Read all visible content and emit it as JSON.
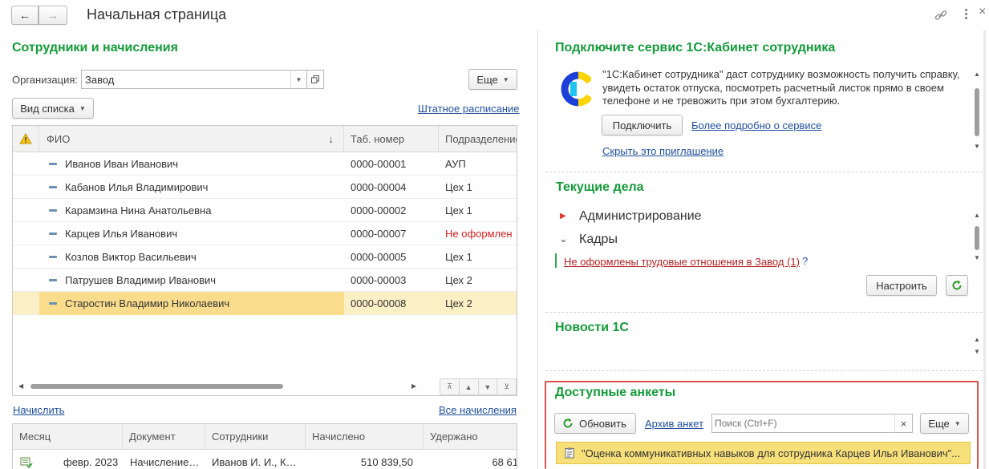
{
  "window": {
    "title": "Начальная страница",
    "nav_back": "←",
    "nav_forward": "→"
  },
  "employees": {
    "title": "Сотрудники и начисления",
    "org_label": "Организация:",
    "org_value": "Завод",
    "more_label": "Еще",
    "view_list_label": "Вид списка",
    "staff_schedule_link": "Штатное расписание",
    "columns": {
      "warn": "",
      "fio": "ФИО",
      "sort_arrow": "↓",
      "tab_number": "Таб. номер",
      "department": "Подразделение"
    },
    "rows": [
      {
        "fio": "Иванов Иван Иванович",
        "tab": "0000-00001",
        "dept": "АУП",
        "dept_color": "#333333"
      },
      {
        "fio": "Кабанов Илья Владимирович",
        "tab": "0000-00004",
        "dept": "Цех 1",
        "dept_color": "#333333"
      },
      {
        "fio": "Карамзина Нина Анатольевна",
        "tab": "0000-00002",
        "dept": "Цех 1",
        "dept_color": "#333333"
      },
      {
        "fio": "Карцев Илья Иванович",
        "tab": "0000-00007",
        "dept": "Не оформлен",
        "dept_color": "#d42020"
      },
      {
        "fio": "Козлов Виктор Васильевич",
        "tab": "0000-00005",
        "dept": "Цех 1",
        "dept_color": "#333333"
      },
      {
        "fio": "Патрушев Владимир Иванович",
        "tab": "0000-00003",
        "dept": "Цех 2",
        "dept_color": "#333333"
      },
      {
        "fio": "Старостин Владимир Николаевич",
        "tab": "0000-00008",
        "dept": "Цех 2",
        "dept_color": "#333333"
      }
    ],
    "selected_row": 6,
    "accrue_link": "Начислить",
    "all_accruals_link": "Все начисления"
  },
  "accruals": {
    "columns": {
      "month": "Месяц",
      "document": "Документ",
      "employees": "Сотрудники",
      "accrued": "Начислено",
      "withheld": "Удержано"
    },
    "rows": [
      {
        "month": "февр. 2023",
        "document": "Начисление…",
        "employees": "Иванов И. И., К…",
        "accrued": "510 839,50",
        "withheld": "68 61"
      }
    ]
  },
  "cabinet": {
    "title": "Подключите сервис 1С:Кабинет сотрудника",
    "description": "\"1С:Кабинет сотрудника\" даст сотруднику возможность получить справку, увидеть остаток отпуска, посмотреть расчетный листок прямо в своем телефоне и не тревожить при этом бухгалтерию.",
    "connect_button": "Подключить",
    "more_link": "Более подробно о сервисе",
    "hide_link": "Скрыть это приглашение"
  },
  "tasks": {
    "title": "Текущие дела",
    "items": [
      {
        "label": "Администрирование",
        "icon": "triangle-right"
      },
      {
        "label": "Кадры",
        "icon": "chevron-down"
      }
    ],
    "alert_link": "Не оформлены трудовые отношения в Завод (1)",
    "help": "?",
    "configure_button": "Настроить"
  },
  "news": {
    "title": "Новости 1С"
  },
  "surveys": {
    "title": "Доступные анкеты",
    "refresh_button": "Обновить",
    "archive_link": "Архив анкет",
    "search_placeholder": "Поиск (Ctrl+F)",
    "clear": "×",
    "more_label": "Еще",
    "item": "\"Оценка коммуникативных навыков для сотрудника Карцев Илья Иванович\"..."
  },
  "colors": {
    "accent_green": "#159a3a",
    "link_blue": "#1f4f9c",
    "highlight_red": "#d9534f",
    "selected_row": "#fbefc5",
    "selected_cell": "#f9dc8c",
    "survey_item": "#f7e07a"
  }
}
